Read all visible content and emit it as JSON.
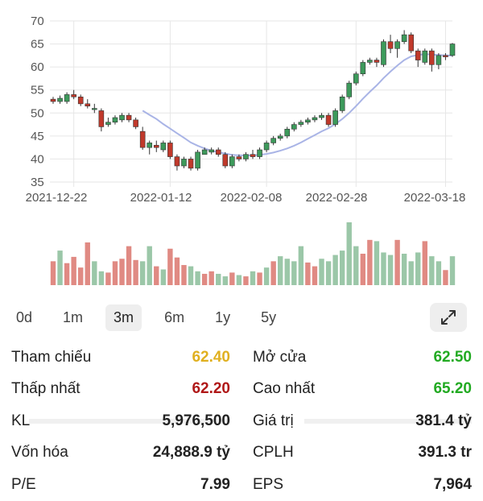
{
  "chart_data": {
    "type": "candlestick",
    "ylim": [
      35,
      70
    ],
    "yticks": [
      35,
      40,
      45,
      50,
      55,
      60,
      65,
      70
    ],
    "xtick_labels": [
      "2021-12-22",
      "2022-01-12",
      "2022-02-08",
      "2022-02-28",
      "2022-03-18"
    ],
    "candles": [
      [
        53,
        53.5,
        52,
        52.5
      ],
      [
        52.5,
        53.8,
        52,
        53.2
      ],
      [
        52.5,
        54.5,
        52,
        54
      ],
      [
        54,
        55,
        53,
        53.5
      ],
      [
        53.5,
        54,
        51.5,
        52
      ],
      [
        52,
        53,
        51,
        51.5
      ],
      [
        51,
        52,
        50,
        51
      ],
      [
        50.5,
        51,
        46,
        47
      ],
      [
        47.5,
        49,
        47,
        48
      ],
      [
        48,
        49.5,
        47.5,
        49
      ],
      [
        48.5,
        50,
        48,
        49.5
      ],
      [
        49.5,
        50,
        48,
        48.5
      ],
      [
        48.5,
        49,
        46.5,
        47
      ],
      [
        46,
        47,
        42,
        42.5
      ],
      [
        42.5,
        44,
        41,
        43.5
      ],
      [
        43,
        44,
        41.5,
        42.5
      ],
      [
        42,
        44,
        41.5,
        43.5
      ],
      [
        43.5,
        44,
        40,
        40.5
      ],
      [
        40.5,
        41,
        37.5,
        38.5
      ],
      [
        38.5,
        40.5,
        38,
        40
      ],
      [
        40,
        40.5,
        37.5,
        38
      ],
      [
        38,
        42,
        37.5,
        41.5
      ],
      [
        41,
        42.5,
        41,
        42
      ],
      [
        41.5,
        42.5,
        41,
        42
      ],
      [
        42,
        42.5,
        40.5,
        41
      ],
      [
        41,
        41.5,
        38,
        38.5
      ],
      [
        38.5,
        41,
        38,
        40.5
      ],
      [
        40.5,
        41,
        39.5,
        40
      ],
      [
        40,
        41.5,
        39.5,
        41
      ],
      [
        41,
        42,
        40,
        40.5
      ],
      [
        40.5,
        42.5,
        40,
        42
      ],
      [
        42,
        44,
        41.5,
        43.5
      ],
      [
        43.5,
        45,
        43,
        44.5
      ],
      [
        44.5,
        45.5,
        44,
        45
      ],
      [
        45,
        47,
        44.5,
        46.5
      ],
      [
        46.5,
        48,
        46,
        47.5
      ],
      [
        47.5,
        48.5,
        47,
        48
      ],
      [
        48,
        49,
        47.5,
        48.5
      ],
      [
        48.5,
        49.5,
        48,
        49
      ],
      [
        49,
        50,
        48.5,
        49.5
      ],
      [
        49.5,
        50,
        47,
        47.5
      ],
      [
        47.5,
        51,
        47,
        50.5
      ],
      [
        50.5,
        54,
        50,
        53.5
      ],
      [
        53.5,
        57,
        53,
        56.5
      ],
      [
        56.5,
        59,
        56,
        58.5
      ],
      [
        58.5,
        61.5,
        58,
        61
      ],
      [
        61,
        62,
        60.5,
        61.5
      ],
      [
        61.5,
        62,
        60,
        61
      ],
      [
        60.5,
        66,
        60,
        65.5
      ],
      [
        65.5,
        67,
        63,
        64
      ],
      [
        64,
        66,
        62,
        65.5
      ],
      [
        65.5,
        68,
        65,
        67
      ],
      [
        67,
        67.5,
        63,
        63.5
      ],
      [
        63.5,
        64,
        60,
        61.5
      ],
      [
        61,
        64,
        60.5,
        63.5
      ],
      [
        63.5,
        64,
        59,
        60.5
      ],
      [
        60.5,
        63,
        59.5,
        62.5
      ],
      [
        62.5,
        63,
        61.5,
        62.2
      ],
      [
        62.5,
        65.2,
        62.2,
        65
      ]
    ],
    "ma": [
      null,
      null,
      null,
      null,
      null,
      null,
      null,
      null,
      null,
      null,
      null,
      null,
      null,
      50.5,
      49.6,
      48.7,
      47.6,
      46.6,
      45.6,
      44.6,
      43.6,
      42.9,
      42.3,
      41.8,
      41.5,
      41.2,
      40.9,
      40.8,
      40.8,
      40.8,
      40.9,
      41.1,
      41.4,
      41.8,
      42.3,
      42.9,
      43.6,
      44.4,
      45.2,
      46.0,
      46.7,
      47.6,
      48.7,
      50.0,
      51.5,
      53.1,
      54.6,
      56.0,
      57.6,
      59.0,
      60.3,
      61.5,
      62.3,
      62.6,
      62.8,
      62.7,
      62.6,
      62.5,
      62.5
    ],
    "volumes": [
      [
        0.38,
        "red"
      ],
      [
        0.55,
        "green"
      ],
      [
        0.35,
        "red"
      ],
      [
        0.45,
        "red"
      ],
      [
        0.28,
        "red"
      ],
      [
        0.68,
        "red"
      ],
      [
        0.38,
        "green"
      ],
      [
        0.22,
        "green"
      ],
      [
        0.2,
        "red"
      ],
      [
        0.38,
        "red"
      ],
      [
        0.42,
        "red"
      ],
      [
        0.62,
        "red"
      ],
      [
        0.4,
        "red"
      ],
      [
        0.38,
        "green"
      ],
      [
        0.62,
        "green"
      ],
      [
        0.3,
        "red"
      ],
      [
        0.25,
        "green"
      ],
      [
        0.58,
        "red"
      ],
      [
        0.44,
        "red"
      ],
      [
        0.32,
        "red"
      ],
      [
        0.3,
        "green"
      ],
      [
        0.22,
        "green"
      ],
      [
        0.18,
        "red"
      ],
      [
        0.22,
        "red"
      ],
      [
        0.18,
        "green"
      ],
      [
        0.14,
        "green"
      ],
      [
        0.2,
        "red"
      ],
      [
        0.16,
        "green"
      ],
      [
        0.14,
        "red"
      ],
      [
        0.22,
        "green"
      ],
      [
        0.2,
        "red"
      ],
      [
        0.28,
        "green"
      ],
      [
        0.38,
        "red"
      ],
      [
        0.46,
        "green"
      ],
      [
        0.42,
        "green"
      ],
      [
        0.38,
        "green"
      ],
      [
        0.62,
        "green"
      ],
      [
        0.36,
        "red"
      ],
      [
        0.3,
        "red"
      ],
      [
        0.42,
        "green"
      ],
      [
        0.38,
        "green"
      ],
      [
        0.48,
        "green"
      ],
      [
        0.55,
        "green"
      ],
      [
        1.0,
        "green"
      ],
      [
        0.62,
        "green"
      ],
      [
        0.5,
        "red"
      ],
      [
        0.72,
        "red"
      ],
      [
        0.7,
        "green"
      ],
      [
        0.52,
        "green"
      ],
      [
        0.48,
        "green"
      ],
      [
        0.72,
        "red"
      ],
      [
        0.5,
        "green"
      ],
      [
        0.38,
        "green"
      ],
      [
        0.52,
        "green"
      ],
      [
        0.7,
        "red"
      ],
      [
        0.46,
        "green"
      ],
      [
        0.38,
        "green"
      ],
      [
        0.24,
        "red"
      ],
      [
        0.46,
        "green"
      ]
    ],
    "colors": {
      "up": "#3d9a5b",
      "down": "#c0392b",
      "ma": "#a9b4e6",
      "vol_up": "#9bc7a8",
      "vol_down": "#e08a83",
      "grid": "#e6e6e6"
    }
  },
  "tabs": [
    "0d",
    "1m",
    "3m",
    "6m",
    "1y",
    "5y"
  ],
  "active_tab": "3m",
  "stats": {
    "ref_label": "Tham chiếu",
    "ref_value": "62.40",
    "open_label": "Mở cửa",
    "open_value": "62.50",
    "low_label": "Thấp nhất",
    "low_value": "62.20",
    "high_label": "Cao nhất",
    "high_value": "65.20",
    "vol_label": "KL",
    "vol_value": "5,976,500",
    "valtrade_label": "Giá trị",
    "valtrade_value": "381.4 tỷ",
    "cap_label": "Vốn hóa",
    "cap_value": "24,888.9 tỷ",
    "shares_label": "CPLH",
    "shares_value": "391.3 tr",
    "pe_label": "P/E",
    "pe_value": "7.99",
    "eps_label": "EPS",
    "eps_value": "7,964"
  }
}
